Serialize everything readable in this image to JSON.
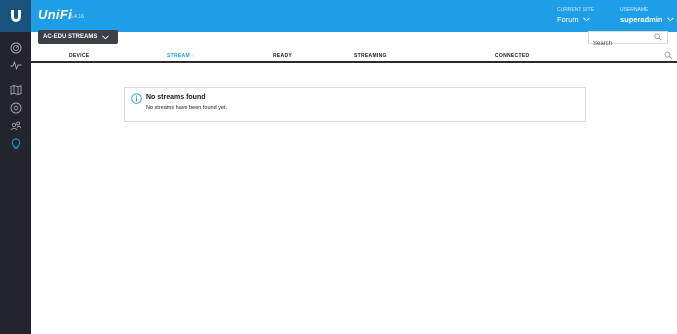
{
  "header": {
    "brand": "UniFi",
    "version": "5.4.16",
    "site_label": "CURRENT SITE",
    "site_value": "Forum",
    "user_label": "USERNAME",
    "user_value": "superadmin"
  },
  "sidebar": {
    "items": [
      {
        "icon": "dashboard-icon",
        "active": false
      },
      {
        "icon": "statistics-icon",
        "active": false
      },
      {
        "icon": "map-icon",
        "active": false
      },
      {
        "icon": "devices-icon",
        "active": false
      },
      {
        "icon": "clients-icon",
        "active": false
      },
      {
        "icon": "insights-icon",
        "active": true
      }
    ]
  },
  "toolbar": {
    "dropdown_value": "AC-EDU STREAMS",
    "search_placeholder": "Search"
  },
  "table": {
    "columns": [
      "DEVICE",
      "STREAM",
      "READY",
      "STREAMING",
      "CONNECTED"
    ],
    "sorted_column": "STREAM",
    "sort_direction": "ascending"
  },
  "empty_state": {
    "title": "No streams found",
    "message": "No streams have been found yet."
  },
  "colors": {
    "header_blue": "#1e9ee6",
    "logo_dark_blue": "#17537d",
    "sidebar_dark": "#22252e",
    "active_icon": "#1e9ee6"
  }
}
